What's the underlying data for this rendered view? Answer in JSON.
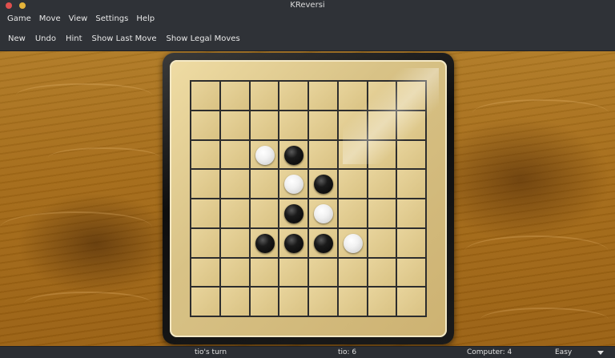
{
  "window": {
    "title": "KReversi"
  },
  "menu": [
    "Game",
    "Move",
    "View",
    "Settings",
    "Help"
  ],
  "toolbar": [
    "New",
    "Undo",
    "Hint",
    "Show Last Move",
    "Show Legal Moves"
  ],
  "board": {
    "size": 8,
    "pieces": [
      {
        "row": 3,
        "col": 3,
        "color": "white"
      },
      {
        "row": 3,
        "col": 4,
        "color": "black"
      },
      {
        "row": 4,
        "col": 4,
        "color": "white"
      },
      {
        "row": 4,
        "col": 5,
        "color": "black"
      },
      {
        "row": 5,
        "col": 4,
        "color": "black"
      },
      {
        "row": 5,
        "col": 5,
        "color": "white"
      },
      {
        "row": 6,
        "col": 3,
        "color": "black"
      },
      {
        "row": 6,
        "col": 4,
        "color": "black"
      },
      {
        "row": 6,
        "col": 5,
        "color": "black"
      },
      {
        "row": 6,
        "col": 6,
        "color": "white"
      }
    ]
  },
  "status": {
    "turn": "tio's turn",
    "player_score": "tio: 6",
    "computer_score": "Computer: 4",
    "difficulty": "Easy"
  },
  "colors": {
    "accent_close": "#e0504e",
    "accent_minimize": "#e5b43a",
    "wood": "#a46a17",
    "board": "#d8c286"
  }
}
